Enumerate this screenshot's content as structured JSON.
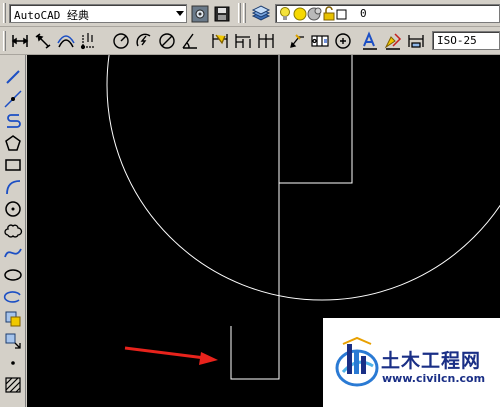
{
  "toolbar_top": {
    "workspace_combo": {
      "value": "AutoCAD 经典"
    },
    "layer_combo": {
      "value": "0"
    }
  },
  "toolbar_dim": {
    "dimstyle_combo": {
      "value": "ISO-25"
    }
  },
  "watermark": {
    "brand": "土木工程网",
    "url": "www.civilcn.com"
  },
  "colors": {
    "canvas": "#000000",
    "geometry": "#ffffff",
    "arrow": "#e8231c",
    "watermark_text": "#1a2f86"
  }
}
